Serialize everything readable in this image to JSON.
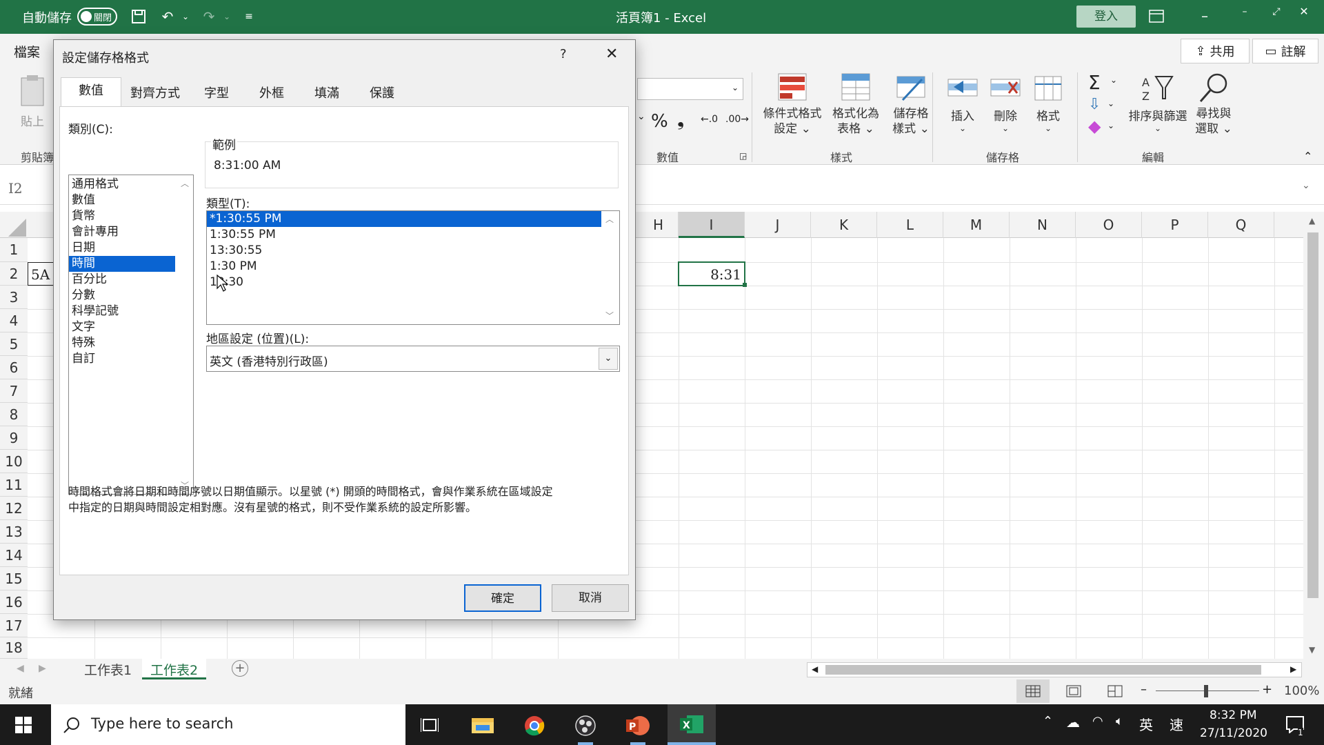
{
  "titlebar": {
    "autosave_label": "自動儲存",
    "autosave_state": "關閉",
    "title": "活頁簿1 - Excel",
    "signin": "登入"
  },
  "ribbon": {
    "file_tab": "檔案",
    "share": "共用",
    "comments": "註解",
    "paste": "貼上",
    "clipboard_group": "剪貼簿",
    "number_group": "數值",
    "styles_group": "樣式",
    "cells_group": "儲存格",
    "editing_group": "編輯",
    "conditional_format": [
      "條件式格式",
      "設定"
    ],
    "format_as_table": [
      "格式化為",
      "表格"
    ],
    "cell_styles": [
      "儲存格",
      "樣式"
    ],
    "insert": "插入",
    "delete": "刪除",
    "format": "格式",
    "sort_filter": "排序與篩選",
    "find_select": [
      "尋找與",
      "選取"
    ]
  },
  "formula_bar": {
    "name_box": "I2"
  },
  "grid": {
    "columns": [
      "H",
      "I",
      "J",
      "K",
      "L",
      "M",
      "N",
      "O",
      "P",
      "Q"
    ],
    "rows": [
      "1",
      "2",
      "3",
      "4",
      "5",
      "6",
      "7",
      "8",
      "9",
      "10",
      "11",
      "12",
      "13",
      "14",
      "15",
      "16",
      "17",
      "18"
    ],
    "cell_a2": "5A",
    "cell_i2": "8:31"
  },
  "sheets": {
    "tabs": [
      "工作表1",
      "工作表2"
    ],
    "active": "工作表2"
  },
  "status": {
    "ready": "就緒",
    "zoom": "100%"
  },
  "taskbar": {
    "search_placeholder": "Type here to search",
    "ime1": "英",
    "ime2": "速",
    "time": "8:32 PM",
    "date": "27/11/2020",
    "notification_count": "1"
  },
  "dialog": {
    "title": "設定儲存格格式",
    "help": "?",
    "tabs": [
      "數值",
      "對齊方式",
      "字型",
      "外框",
      "填滿",
      "保護"
    ],
    "category_label": "類別(C):",
    "categories": [
      "通用格式",
      "數值",
      "貨幣",
      "會計專用",
      "日期",
      "時間",
      "百分比",
      "分數",
      "科學記號",
      "文字",
      "特殊",
      "自訂"
    ],
    "selected_category": "時間",
    "sample_label": "範例",
    "sample_value": "8:31:00 AM",
    "type_label": "類型(T):",
    "types": [
      "*1:30:55 PM",
      "1:30:55 PM",
      "13:30:55",
      "1:30 PM",
      "13:30"
    ],
    "locale_label": "地區設定 (位置)(L):",
    "locale_value": "英文 (香港特別行政區)",
    "description": [
      "時間格式會將日期和時間序號以日期值顯示。以星號 (*) 開頭的時間格式，會與作業系統在區域設定",
      "中指定的日期與時間設定相對應。沒有星號的格式，則不受作業系統的設定所影響。"
    ],
    "ok": "確定",
    "cancel": "取消"
  }
}
